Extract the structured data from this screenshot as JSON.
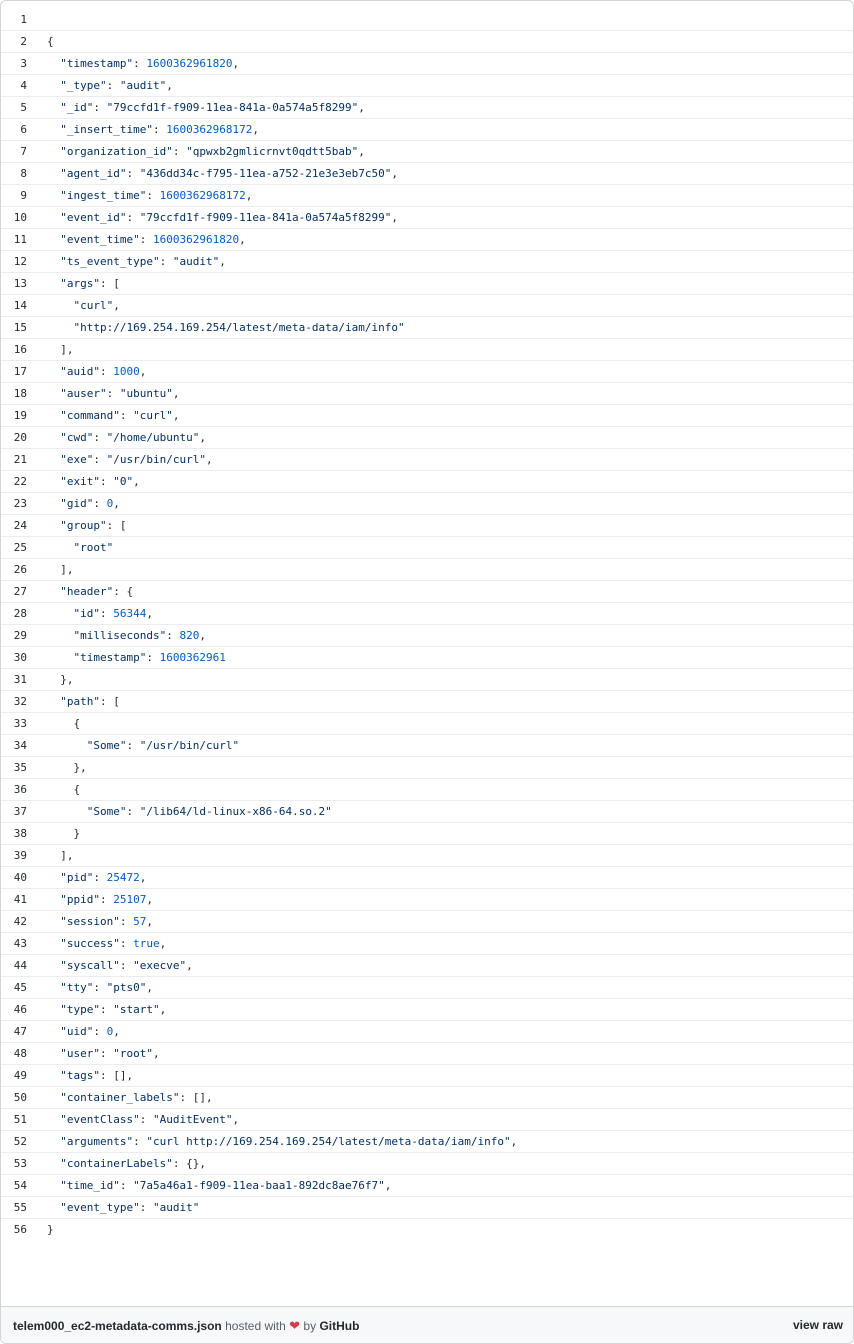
{
  "code_lines": [
    "",
    "{",
    "  \"timestamp\": 1600362961820,",
    "  \"_type\": \"audit\",",
    "  \"_id\": \"79ccfd1f-f909-11ea-841a-0a574a5f8299\",",
    "  \"_insert_time\": 1600362968172,",
    "  \"organization_id\": \"qpwxb2gmlicrnvt0qdtt5bab\",",
    "  \"agent_id\": \"436dd34c-f795-11ea-a752-21e3e3eb7c50\",",
    "  \"ingest_time\": 1600362968172,",
    "  \"event_id\": \"79ccfd1f-f909-11ea-841a-0a574a5f8299\",",
    "  \"event_time\": 1600362961820,",
    "  \"ts_event_type\": \"audit\",",
    "  \"args\": [",
    "    \"curl\",",
    "    \"http://169.254.169.254/latest/meta-data/iam/info\"",
    "  ],",
    "  \"auid\": 1000,",
    "  \"auser\": \"ubuntu\",",
    "  \"command\": \"curl\",",
    "  \"cwd\": \"/home/ubuntu\",",
    "  \"exe\": \"/usr/bin/curl\",",
    "  \"exit\": \"0\",",
    "  \"gid\": 0,",
    "  \"group\": [",
    "    \"root\"",
    "  ],",
    "  \"header\": {",
    "    \"id\": 56344,",
    "    \"milliseconds\": 820,",
    "    \"timestamp\": 1600362961",
    "  },",
    "  \"path\": [",
    "    {",
    "      \"Some\": \"/usr/bin/curl\"",
    "    },",
    "    {",
    "      \"Some\": \"/lib64/ld-linux-x86-64.so.2\"",
    "    }",
    "  ],",
    "  \"pid\": 25472,",
    "  \"ppid\": 25107,",
    "  \"session\": 57,",
    "  \"success\": true,",
    "  \"syscall\": \"execve\",",
    "  \"tty\": \"pts0\",",
    "  \"type\": \"start\",",
    "  \"uid\": 0,",
    "  \"user\": \"root\",",
    "  \"tags\": [],",
    "  \"container_labels\": [],",
    "  \"eventClass\": \"AuditEvent\",",
    "  \"arguments\": \"curl http://169.254.169.254/latest/meta-data/iam/info\",",
    "  \"containerLabels\": {},",
    "  \"time_id\": \"7a5a46a1-f909-11ea-baa1-892dc8ae76f7\",",
    "  \"event_type\": \"audit\"",
    "}"
  ],
  "footer": {
    "filename": "telem000_ec2-metadata-comms.json",
    "hosted_with": "hosted with",
    "by": "by",
    "github": "GitHub",
    "view_raw": "view raw"
  },
  "colors": {
    "key": "#032f62",
    "number": "#005cc5",
    "heart": "#d73a49"
  }
}
